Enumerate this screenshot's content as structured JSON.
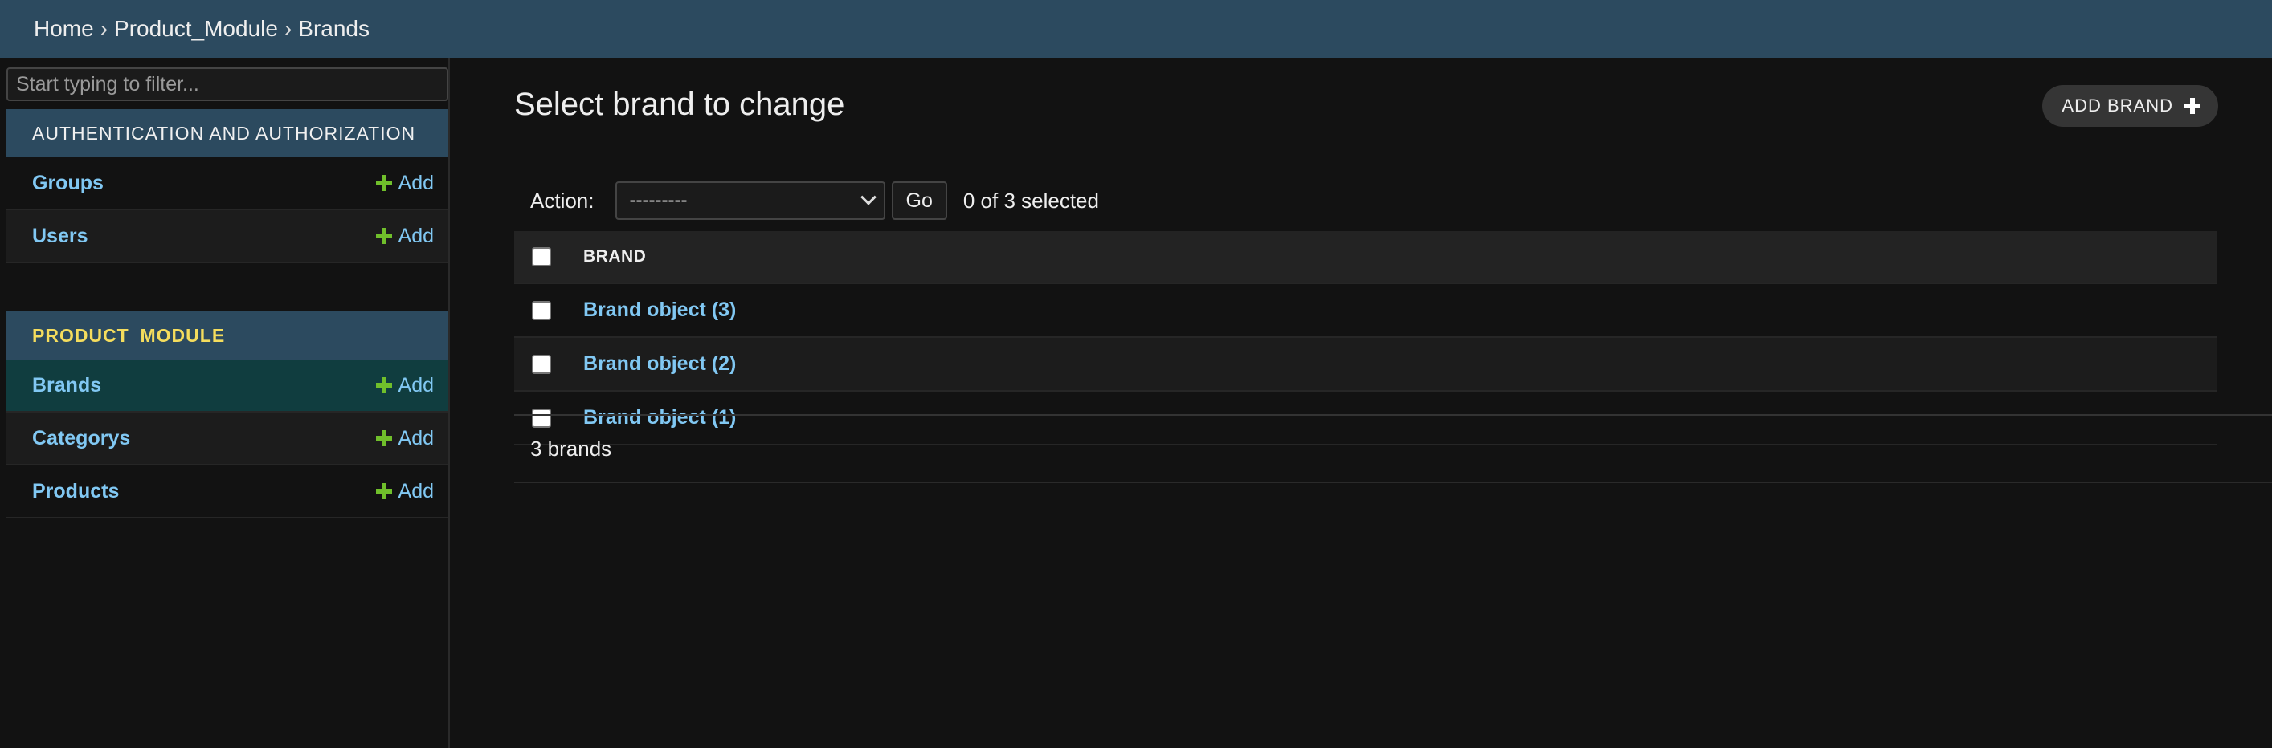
{
  "breadcrumb": {
    "home": "Home",
    "module": "Product_Module",
    "current": "Brands",
    "separator": "›"
  },
  "sidebar": {
    "filter_placeholder": "Start typing to filter...",
    "modules": [
      {
        "caption": "AUTHENTICATION AND AUTHORIZATION",
        "items": [
          {
            "label": "Groups",
            "add": "Add"
          },
          {
            "label": "Users",
            "add": "Add"
          }
        ]
      },
      {
        "caption": "PRODUCT_MODULE",
        "items": [
          {
            "label": "Brands",
            "add": "Add"
          },
          {
            "label": "Categorys",
            "add": "Add"
          },
          {
            "label": "Products",
            "add": "Add"
          }
        ]
      }
    ]
  },
  "main": {
    "title": "Select brand to change",
    "add_button": "ADD BRAND",
    "action_label": "Action:",
    "action_selected": "---------",
    "go_label": "Go",
    "selected_text": "0 of 3 selected",
    "column_header": "BRAND",
    "rows": [
      "Brand object (3)",
      "Brand object (2)",
      "Brand object (1)"
    ],
    "paginator": "3 brands"
  },
  "colors": {
    "header_bg": "#2c4a5f",
    "link": "#81c8f3",
    "add_icon": "#70bf2b",
    "active_caption": "#f5dd5d",
    "current_row": "#103d3f"
  }
}
